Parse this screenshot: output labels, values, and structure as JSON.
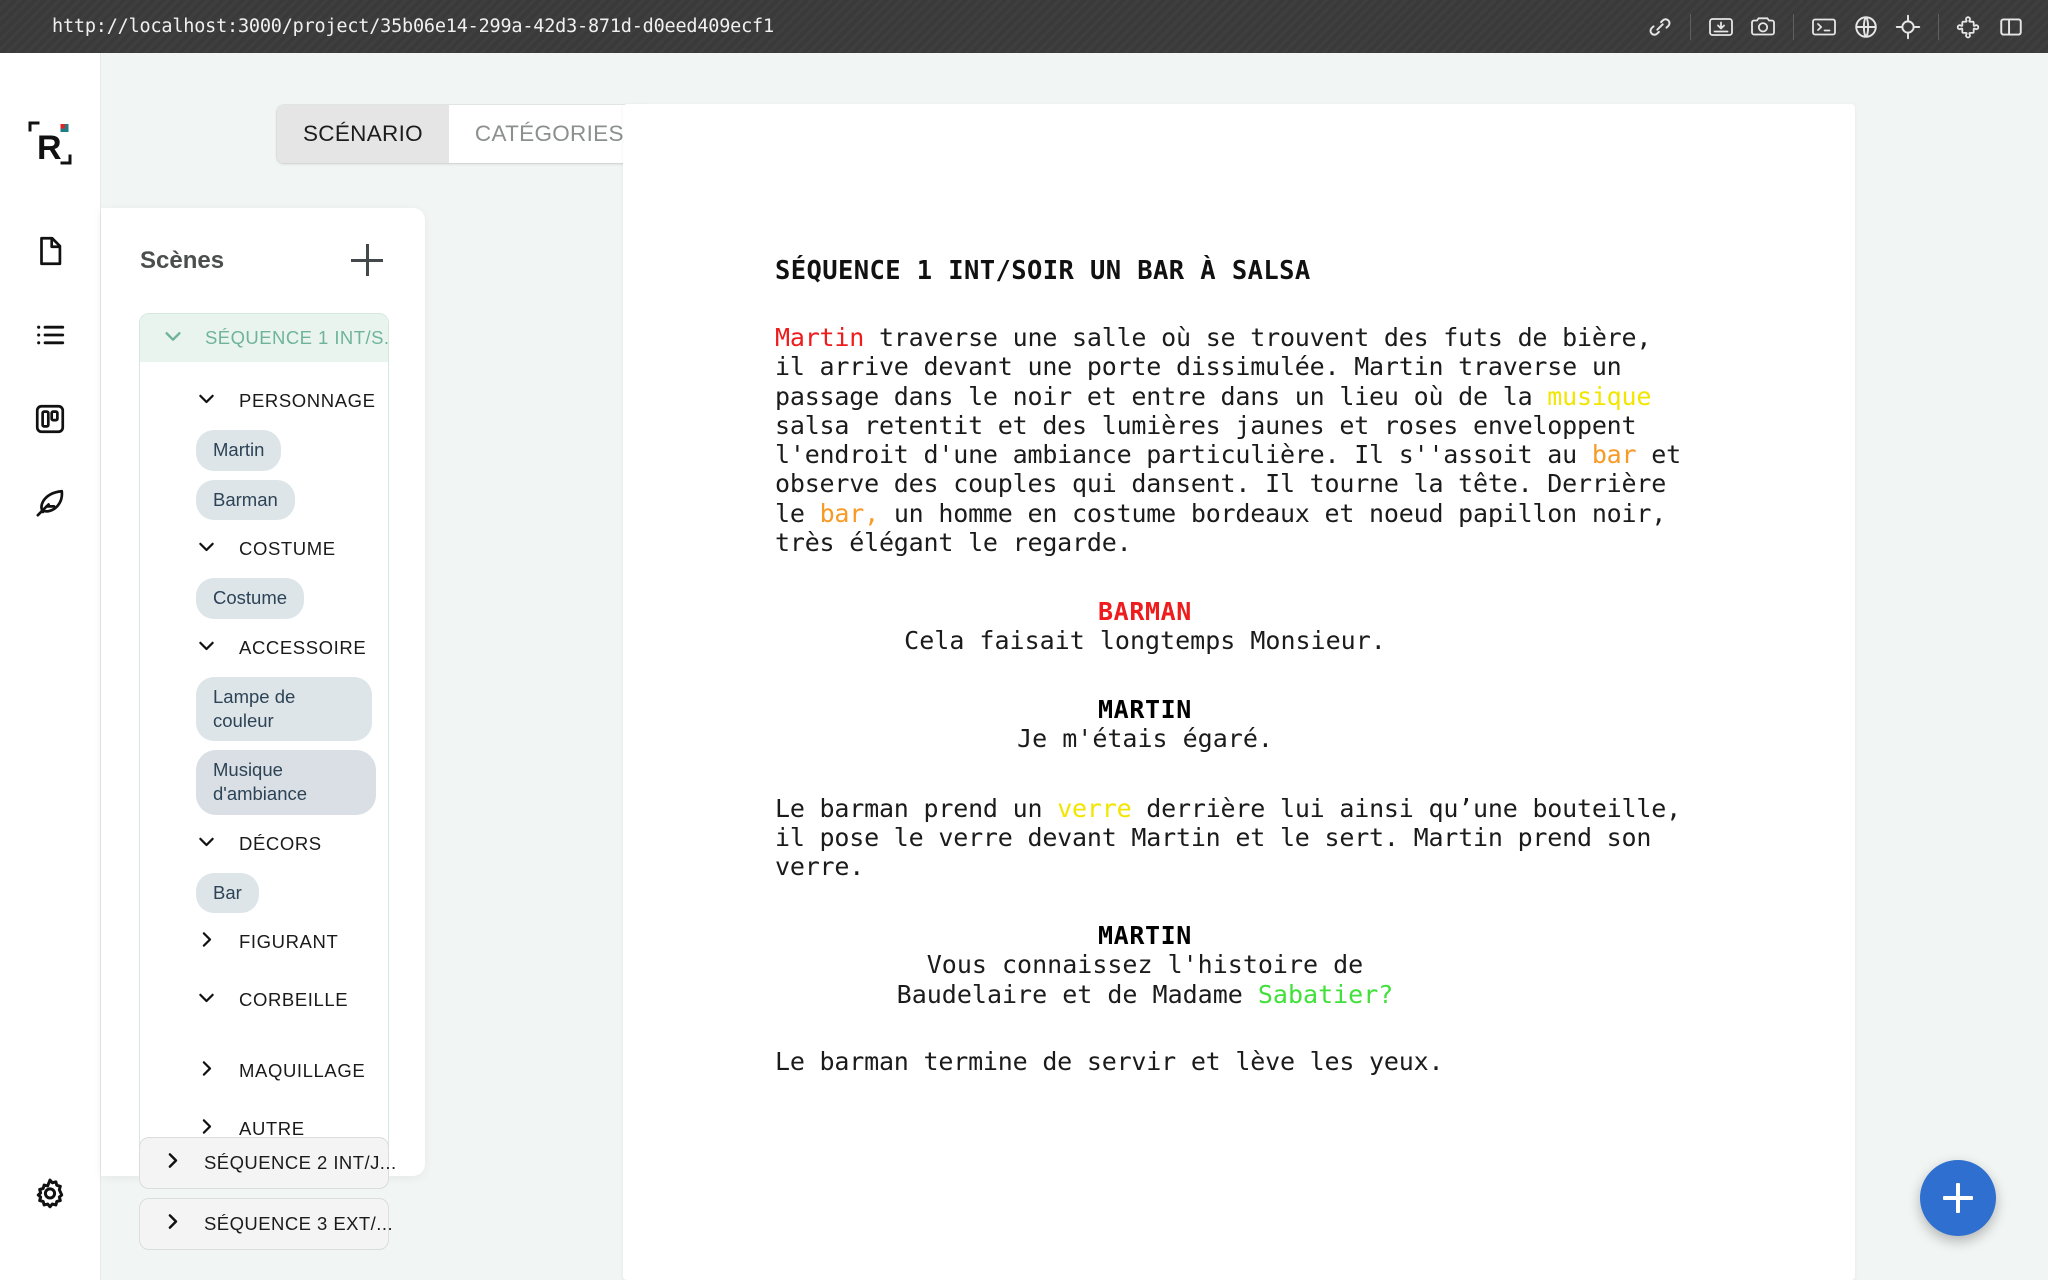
{
  "browser": {
    "info_icon": "info-icon",
    "url": "http://localhost:3000/project/35b06e14-299a-42d3-871d-d0eed409ecf1",
    "actions": [
      {
        "name": "link-icon",
        "title": "Link"
      },
      {
        "name": "download-image-icon",
        "title": "Save image"
      },
      {
        "name": "camera-icon",
        "title": "Screenshot"
      },
      {
        "name": "terminal-icon",
        "title": "Console"
      },
      {
        "name": "globe-icon",
        "title": "Network"
      },
      {
        "name": "crosshair-icon",
        "title": "Inspect element"
      },
      {
        "name": "puzzle-icon",
        "title": "Extensions"
      },
      {
        "name": "split-panel-icon",
        "title": "Toggle panel"
      }
    ]
  },
  "rail": {
    "logo_letter": "R",
    "items": [
      {
        "name": "sidebar-item-document",
        "icon": "document-icon"
      },
      {
        "name": "sidebar-item-list",
        "icon": "list-icon"
      },
      {
        "name": "sidebar-item-board",
        "icon": "board-icon"
      },
      {
        "name": "sidebar-item-writing",
        "icon": "feather-icon"
      }
    ],
    "settings": {
      "name": "sidebar-item-settings",
      "icon": "gear-icon"
    }
  },
  "tabs": [
    {
      "label": "SCÉNARIO",
      "active": true
    },
    {
      "label": "CATÉGORIES",
      "active": false
    }
  ],
  "panel": {
    "title": "Scènes",
    "add_button": "add-scene-button",
    "sequence_open": {
      "label": "SÉQUENCE 1 INT/S...",
      "expanded": true,
      "categories": [
        {
          "label": "PERSONNAGE",
          "expanded": true,
          "tags": [
            "Martin",
            "Barman"
          ]
        },
        {
          "label": "COSTUME",
          "expanded": true,
          "tags": [
            "Costume"
          ]
        },
        {
          "label": "ACCESSOIRE",
          "expanded": true,
          "tags": [
            "Lampe de couleur",
            "Musique d'ambiance"
          ]
        },
        {
          "label": "DÉCORS",
          "expanded": true,
          "tags": [
            "Bar"
          ]
        },
        {
          "label": "FIGURANT",
          "expanded": false,
          "tags": []
        },
        {
          "label": "CORBEILLE",
          "expanded": true,
          "tags": []
        },
        {
          "label": "MAQUILLAGE",
          "expanded": false,
          "tags": []
        },
        {
          "label": "AUTRE",
          "expanded": false,
          "tags": []
        }
      ]
    },
    "sequences_collapsed": [
      {
        "label": "SÉQUENCE 2 INT/J..."
      },
      {
        "label": "SÉQUENCE 3 EXT/..."
      }
    ]
  },
  "script": {
    "heading": "SÉQUENCE 1 INT/SOIR UN BAR À SALSA",
    "p1": {
      "t1": "Martin",
      "t2": " traverse une salle où se trouvent des futs de bière, il arrive devant une porte dissimulée. Martin traverse un passage dans le noir et entre dans un lieu où de la ",
      "t3": "musique",
      "t4": " salsa retentit et des lumières jaunes et roses enveloppent l'endroit d'une ambiance particulière. Il s''assoit au ",
      "t5": "bar",
      "t6": " et observe des couples qui dansent. Il tourne la tête. Derrière le ",
      "t7": "bar,",
      "t8": " un homme en costume bordeaux et noeud papillon noir, très élégant le regarde."
    },
    "cue1": "BARMAN",
    "line1": "Cela faisait longtemps Monsieur.",
    "cue2": "MARTIN",
    "line2": "Je m'étais égaré.",
    "p2": {
      "t1": "Le barman prend un ",
      "t2": "verre",
      "t3": " derrière lui ainsi qu’une bouteille, il pose le verre devant Martin et le sert. Martin prend son verre."
    },
    "cue3": "MARTIN",
    "line3a": "Vous connaissez l'histoire de",
    "line3b_plain": "Baudelaire et de Madame ",
    "line3b_hl": "Sabatier?",
    "p3": "Le barman termine de servir et lève les yeux."
  },
  "fab": {
    "name": "add-element-button",
    "icon": "plus-icon"
  },
  "colors": {
    "accent_teal": "#6fb49a",
    "fab_blue": "#2f6fd0",
    "hl_red": "#ee1c1c",
    "hl_yellow": "#f2e600",
    "hl_orange": "#f79a26",
    "hl_green": "#41e03a",
    "tag_bg": "#dde5e9",
    "surface": "#f1f5f3"
  }
}
